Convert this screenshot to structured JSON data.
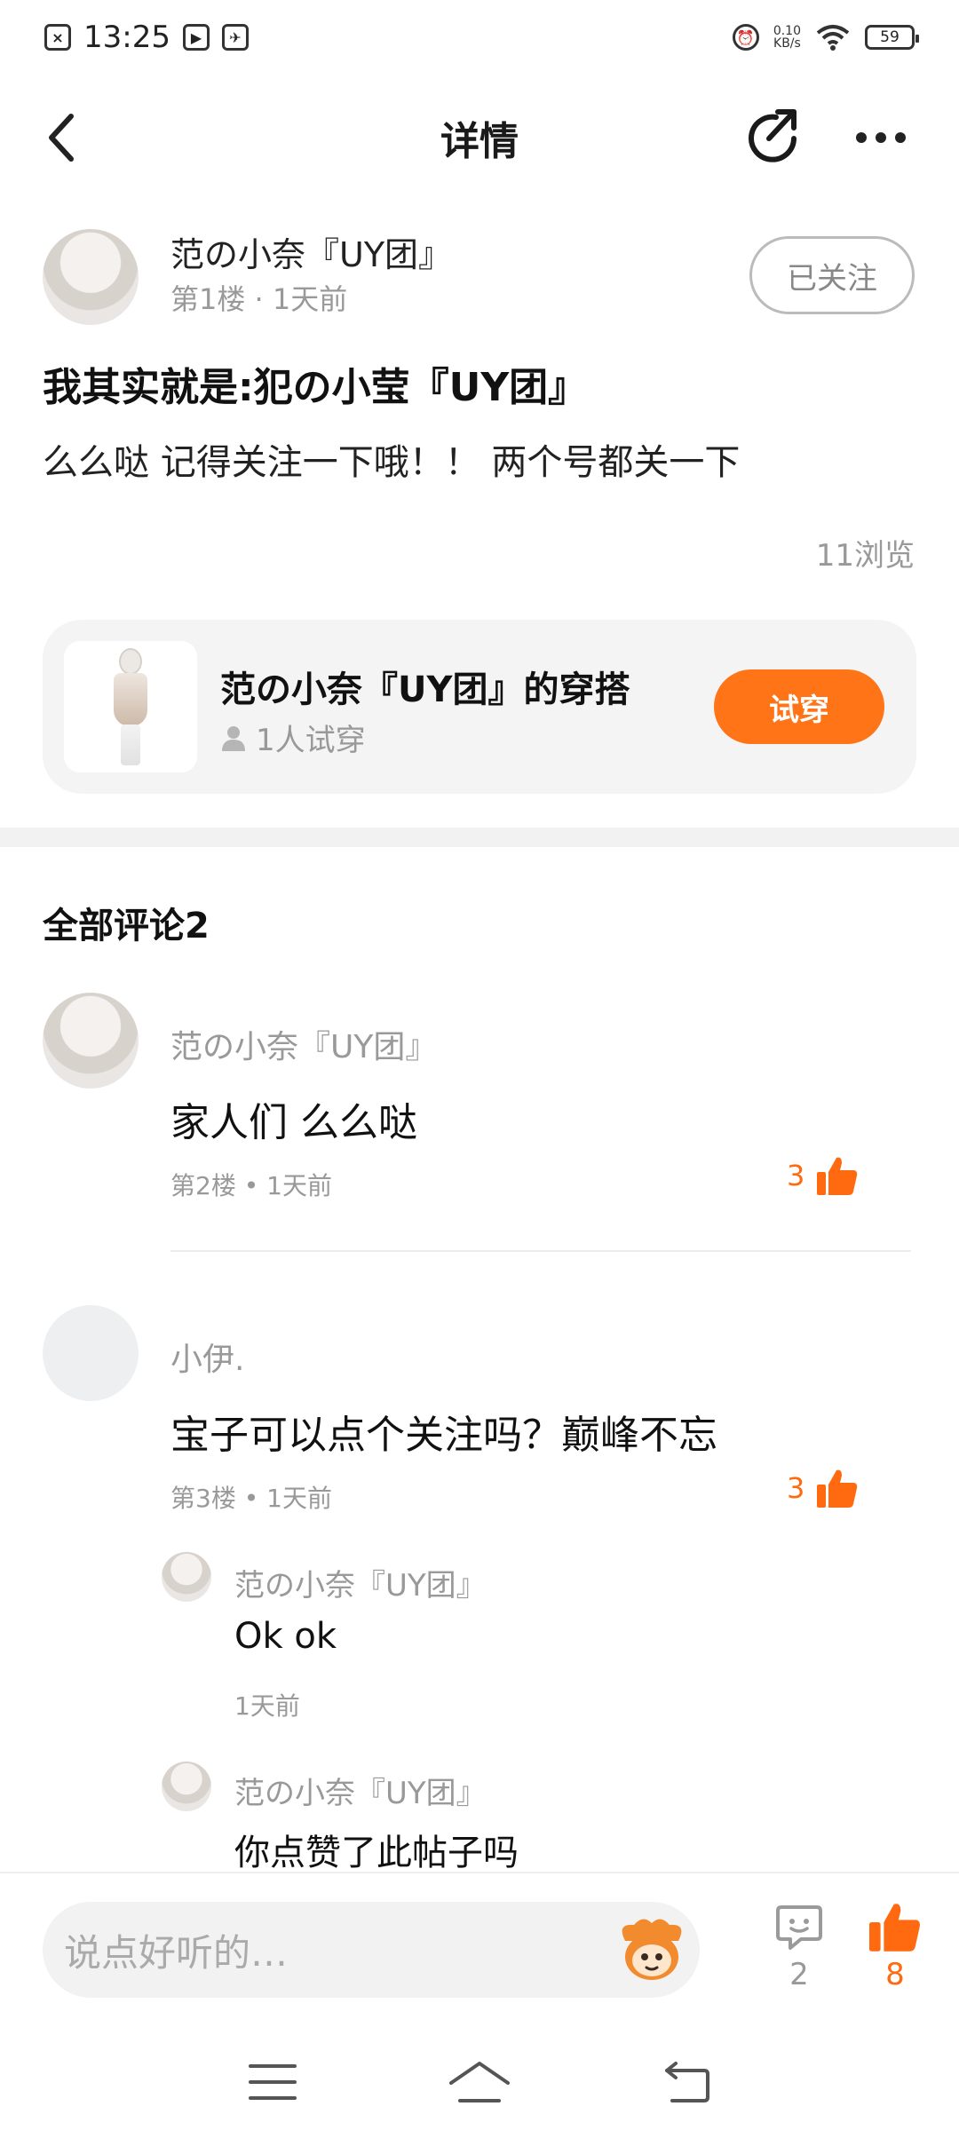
{
  "status_bar": {
    "time": "13:25",
    "net_speed_value": "0.10",
    "net_speed_unit": "KB/s",
    "battery": "59"
  },
  "header": {
    "title": "详情"
  },
  "post": {
    "author_name": "范の小奈『UY团』",
    "author_meta": "第1楼 · 1天前",
    "follow_label": "已关注",
    "title": "我其实就是:犯の小莹『UY团』",
    "body": "么么哒 记得关注一下哦！！ 两个号都关一下",
    "views": "11浏览"
  },
  "outfit_card": {
    "title": "范の小奈『UY团』的穿搭",
    "tryon_count": "1人试穿",
    "tryon_button": "试穿"
  },
  "comments_section": {
    "header": "全部评论2",
    "comments": [
      {
        "author": "范の小奈『UY团』",
        "text": "家人们 么么哒",
        "meta": "第2楼 • 1天前",
        "likes": "3"
      },
      {
        "author": "小伊.",
        "text": "宝子可以点个关注吗？巅峰不忘",
        "meta": "第3楼 • 1天前",
        "likes": "3",
        "replies": [
          {
            "author": "范の小奈『UY团』",
            "text": "Ok  ok",
            "meta": "1天前"
          },
          {
            "author": "范の小奈『UY团』",
            "text": "你点赞了此帖子吗"
          }
        ]
      }
    ]
  },
  "bottom_bar": {
    "input_placeholder": "说点好听的…",
    "comment_count": "2",
    "like_count": "8"
  },
  "colors": {
    "accent": "#ff7416",
    "like": "#ff6a10",
    "muted_text": "#999999"
  }
}
